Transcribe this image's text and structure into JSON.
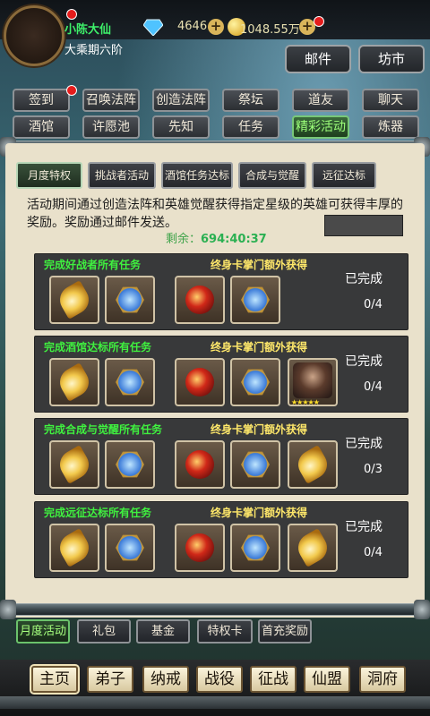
{
  "player": {
    "name": "小陈大仙",
    "rank": "大乘期六阶"
  },
  "currency": {
    "gems": "4646",
    "gold": "1048.55万"
  },
  "top_buttons": {
    "mail": "邮件",
    "market": "坊市"
  },
  "grid_buttons": [
    {
      "label": "签到"
    },
    {
      "label": "召唤法阵"
    },
    {
      "label": "创造法阵"
    },
    {
      "label": "祭坛"
    },
    {
      "label": "道友"
    },
    {
      "label": "聊天"
    },
    {
      "label": "酒馆"
    },
    {
      "label": "许愿池"
    },
    {
      "label": "先知"
    },
    {
      "label": "任务"
    },
    {
      "label": "精彩活动"
    },
    {
      "label": "炼器"
    }
  ],
  "tabs": [
    {
      "label": "月度特权"
    },
    {
      "label": "挑战者活动"
    },
    {
      "label": "酒馆任务达标"
    },
    {
      "label": "合成与觉醒"
    },
    {
      "label": "远征达标"
    }
  ],
  "description": "活动期间通过创造法阵和英雄觉醒获得指定星级的英雄可获得丰厚的奖励。奖励通过邮件发送。",
  "remaining": {
    "label": "剩余：",
    "time": "694:40:37"
  },
  "tasks": [
    {
      "title": "完成好战者所有任务",
      "bonus": "终身卡掌门额外获得",
      "status": "已完成",
      "progress": "0/4",
      "items": [
        "feather",
        "gem",
        "orb",
        "gem"
      ]
    },
    {
      "title": "完成酒馆达标所有任务",
      "bonus": "终身卡掌门额外获得",
      "status": "已完成",
      "progress": "0/4",
      "items": [
        "feather",
        "gem",
        "orb",
        "gem",
        "hero"
      ]
    },
    {
      "title": "完成合成与觉醒所有任务",
      "bonus": "终身卡掌门额外获得",
      "status": "已完成",
      "progress": "0/3",
      "items": [
        "feather",
        "gem",
        "orb",
        "gem",
        "feather"
      ]
    },
    {
      "title": "完成远征达标所有任务",
      "bonus": "终身卡掌门额外获得",
      "status": "已完成",
      "progress": "0/4",
      "items": [
        "feather",
        "gem",
        "orb",
        "gem",
        "feather"
      ]
    }
  ],
  "sub_tabs": [
    {
      "label": "月度活动"
    },
    {
      "label": "礼包"
    },
    {
      "label": "基金"
    },
    {
      "label": "特权卡"
    },
    {
      "label": "首充奖励"
    }
  ],
  "bottom_nav": [
    {
      "label": "主页"
    },
    {
      "label": "弟子"
    },
    {
      "label": "纳戒"
    },
    {
      "label": "战役"
    },
    {
      "label": "征战"
    },
    {
      "label": "仙盟"
    },
    {
      "label": "洞府"
    }
  ]
}
